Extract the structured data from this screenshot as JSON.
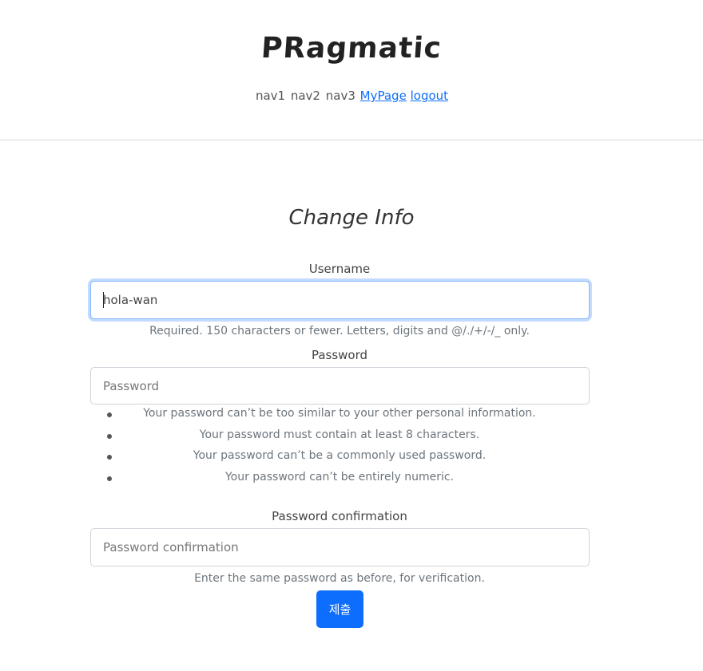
{
  "header": {
    "logo": "PRagmatic",
    "nav": {
      "nav1": "nav1",
      "nav2": "nav2",
      "nav3": "nav3",
      "mypage": "MyPage",
      "logout": "logout"
    }
  },
  "form": {
    "title": "Change Info",
    "username": {
      "label": "Username",
      "value": "hola-wan",
      "help": "Required. 150 characters or fewer. Letters, digits and @/./+/-/_ only."
    },
    "password": {
      "label": "Password",
      "placeholder": "Password",
      "rules": [
        "Your password can’t be too similar to your other personal information.",
        "Your password must contain at least 8 characters.",
        "Your password can’t be a commonly used password.",
        "Your password can’t be entirely numeric."
      ]
    },
    "password_confirmation": {
      "label": "Password confirmation",
      "placeholder": "Password confirmation",
      "help": "Enter the same password as before, for verification."
    },
    "submit_label": "제출"
  },
  "colors": {
    "accent": "#0d6efd",
    "focus_border": "#86b7fe",
    "muted_text": "#6c757d"
  }
}
